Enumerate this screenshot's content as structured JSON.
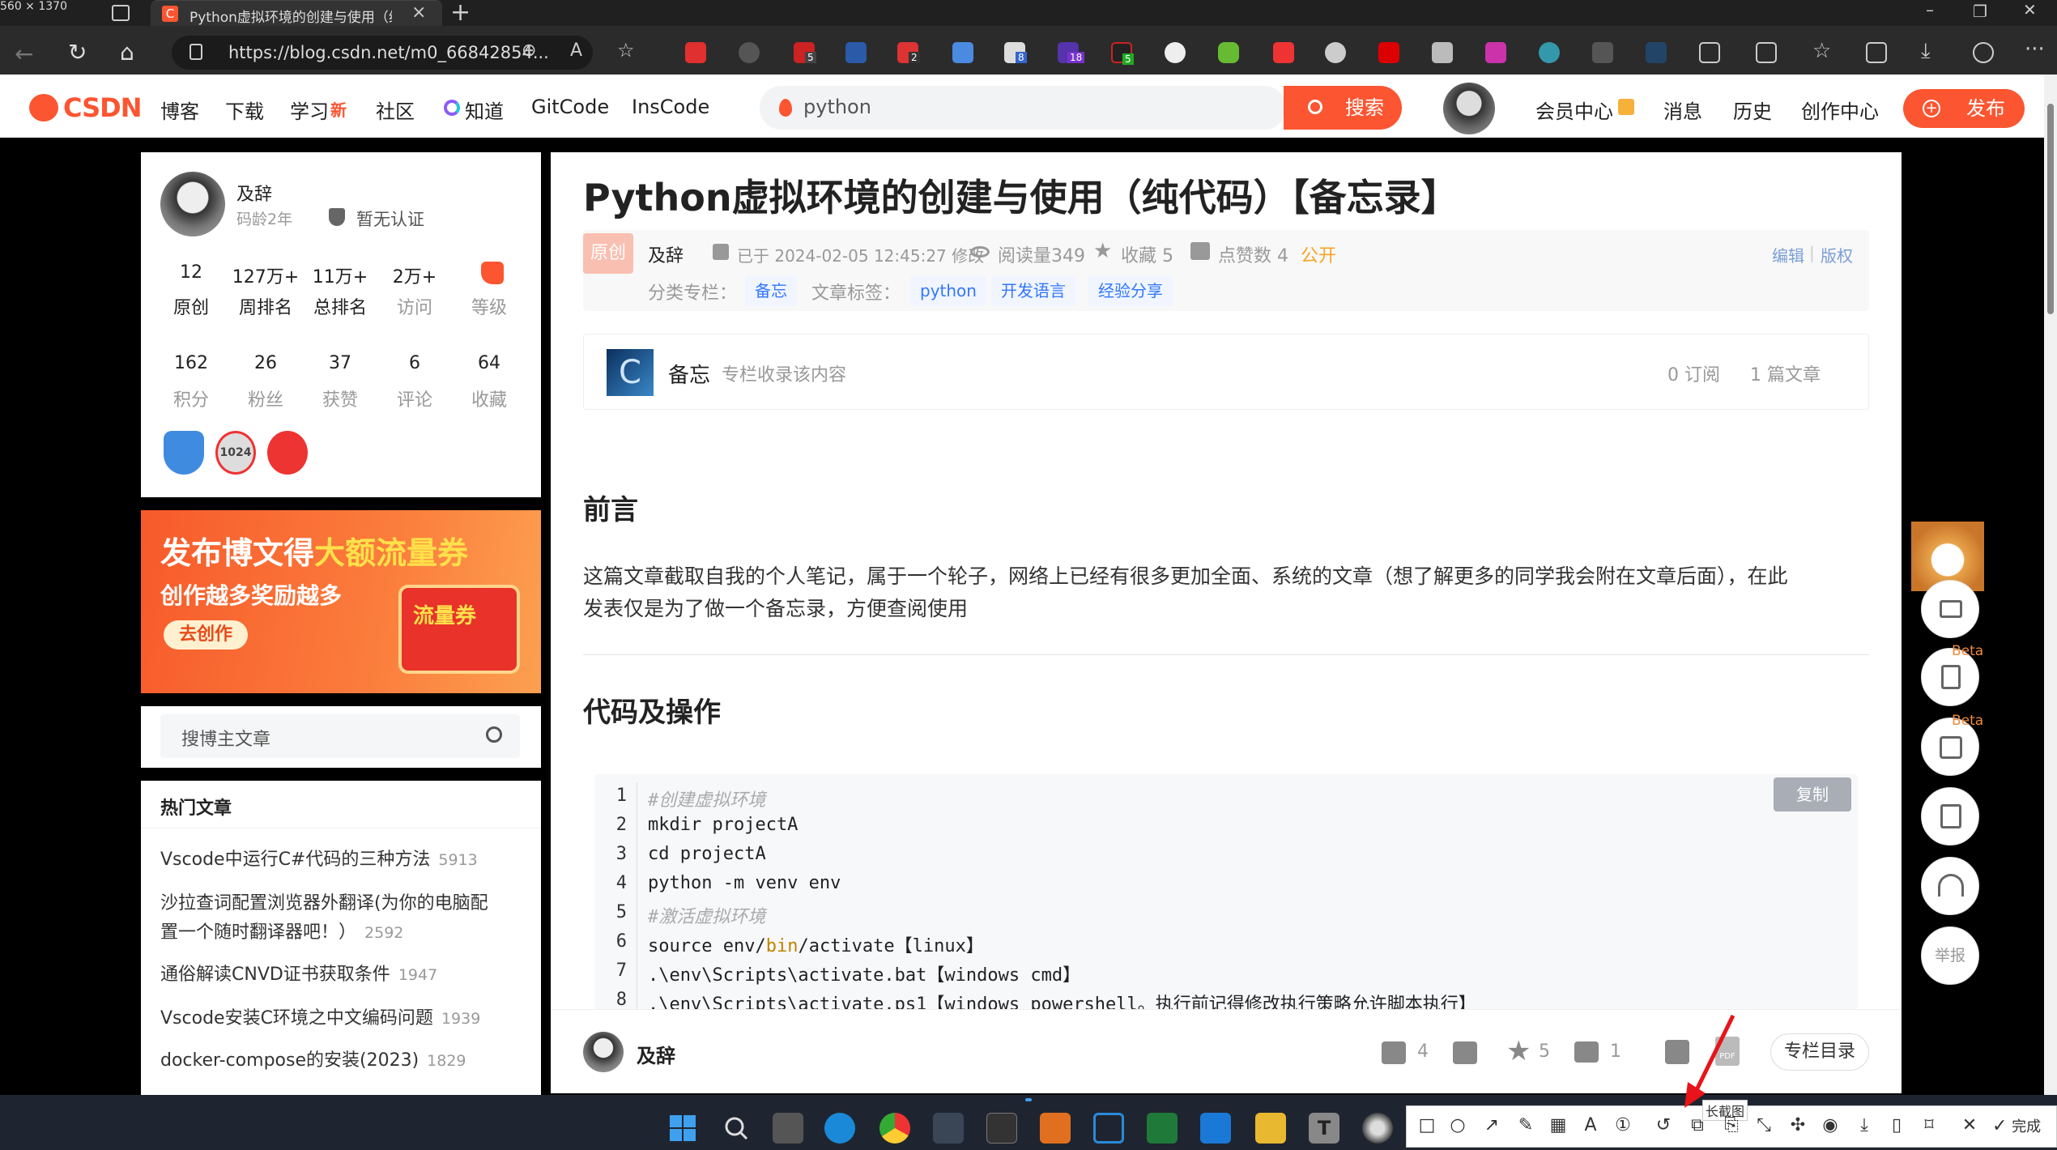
{
  "screen_size_label": "560 × 1370",
  "browser": {
    "tab_title": "Python虚拟环境的创建与使用（纯代码）",
    "new_tab": "+",
    "url": "https://blog.csdn.net/m0_66842854...",
    "extension_badges": [
      "5",
      "2",
      "8",
      "18",
      "5"
    ]
  },
  "header": {
    "logo": "CSDN",
    "nav": [
      "博客",
      "下载",
      "学习",
      "社区",
      "知道",
      "GitCode",
      "InsCode"
    ],
    "new_badge": "新",
    "search_value": "python",
    "search_button": "搜索",
    "right_nav": [
      "会员中心",
      "消息",
      "历史",
      "创作中心"
    ],
    "publish": "发布"
  },
  "profile": {
    "name": "及辞",
    "age": "码龄2年",
    "cert": "暂无认证",
    "stats1": [
      {
        "n": "12",
        "l": "原创"
      },
      {
        "n": "127万+",
        "l": "周排名"
      },
      {
        "n": "11万+",
        "l": "总排名"
      },
      {
        "n": "2万+",
        "l": "访问"
      },
      {
        "n": "",
        "l": "等级"
      }
    ],
    "stats2": [
      {
        "n": "162",
        "l": "积分"
      },
      {
        "n": "26",
        "l": "粉丝"
      },
      {
        "n": "37",
        "l": "获赞"
      },
      {
        "n": "6",
        "l": "评论"
      },
      {
        "n": "64",
        "l": "收藏"
      }
    ],
    "badge_1024": "1024"
  },
  "banner": {
    "line1a": "发布博文得",
    "line1b": "大额流量券",
    "line2": "创作越多奖励越多",
    "cta": "去创作",
    "coupon": "流量券"
  },
  "blog_search": {
    "placeholder": "搜博主文章"
  },
  "hot": {
    "title": "热门文章",
    "items": [
      {
        "t": "Vscode中运行C#代码的三种方法",
        "v": "5913"
      },
      {
        "t": "沙拉查词配置浏览器外翻译(为你的电脑配",
        "t2": "置一个随时翻译器吧！）",
        "v": "2592"
      },
      {
        "t": "通俗解读CNVD证书获取条件",
        "v": "1947"
      },
      {
        "t": "Vscode安装C环境之中文编码问题",
        "v": "1939"
      },
      {
        "t": "docker-compose的安装(2023)",
        "v": "1829"
      }
    ]
  },
  "article": {
    "title": "Python虚拟环境的创建与使用（纯代码）【备忘录】",
    "original": "原创",
    "author": "及辞",
    "modified": "已于 2024-02-05 12:45:27 修改",
    "reads": "阅读量349",
    "favs": "收藏 5",
    "likes": "点赞数 4",
    "public": "公开",
    "edit": "编辑",
    "copyright": "版权",
    "column_label": "分类专栏：",
    "column": "备忘",
    "tags_label": "文章标签：",
    "tags": [
      "python",
      "开发语言",
      "经验分享"
    ],
    "col_box": {
      "name": "备忘",
      "desc": "专栏收录该内容",
      "subs": "0 订阅",
      "count": "1 篇文章"
    },
    "h_preface": "前言",
    "p1": "这篇文章截取自我的个人笔记，属于一个轮子，网络上已经有很多更加全面、系统的文章（想了解更多的同学我会附在文章后面），在此",
    "p2": "发表仅是为了做一个备忘录，方便查阅使用",
    "h_code": "代码及操作",
    "copy": "复制",
    "code": [
      {
        "n": "1",
        "s": "#创建虚拟环境",
        "c": true
      },
      {
        "n": "2",
        "s": "mkdir projectA"
      },
      {
        "n": "3",
        "s": "cd projectA"
      },
      {
        "n": "4",
        "s": "python -m venv env"
      },
      {
        "n": "5",
        "s": "#激活虚拟环境",
        "c": true
      },
      {
        "n": "6",
        "a": "source env/",
        "k": "bin",
        "b": "/activate【linux】"
      },
      {
        "n": "7",
        "s": ".\\env\\Scripts\\activate.bat【windows cmd】"
      },
      {
        "n": "8",
        "s": ".\\env\\Scripts\\activate.ps1【windows powershell。执行前记得修改执行策略允许脚本执行】"
      }
    ]
  },
  "bottom": {
    "author": "及辞",
    "likes": "4",
    "favs": "5",
    "comments": "1",
    "catalog": "专栏目录"
  },
  "float": {
    "beta": "Beta",
    "report": "举报"
  },
  "snip": {
    "long_shot": "长截图",
    "done": "完成"
  },
  "colors": {
    "csdn_red": "#fc5531",
    "link_blue": "#3377ff"
  }
}
